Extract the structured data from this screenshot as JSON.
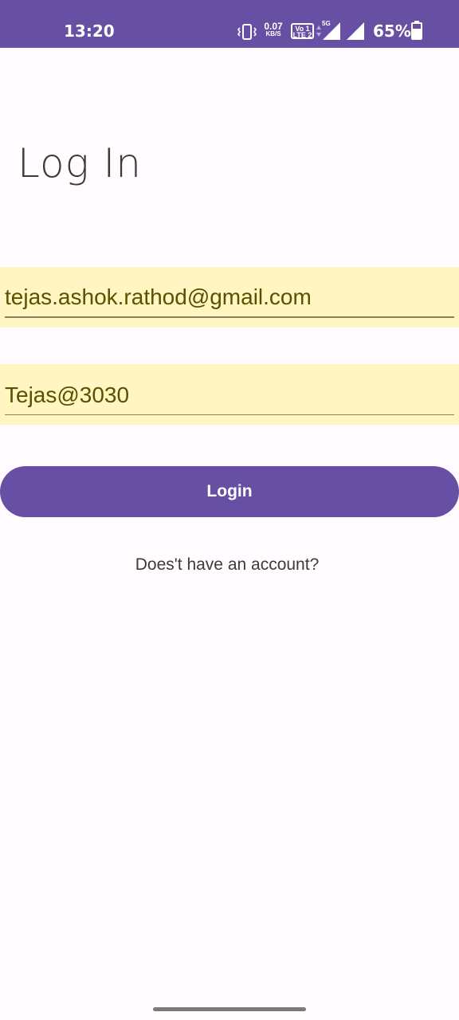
{
  "status_bar": {
    "time": "13:20",
    "net_speed_value": "0.07",
    "net_speed_unit": "KB/S",
    "volte_top": "Vo 1",
    "volte_bottom": "LTE 2",
    "network_type": "5G",
    "battery_percent": "65%",
    "icons": [
      "vibrate-icon",
      "volte-icon",
      "signal-5g-icon",
      "signal-icon",
      "battery-icon"
    ],
    "color": "#6750a4"
  },
  "login": {
    "title": "Log In",
    "email_value": "tejas.ashok.rathod@gmail.com",
    "password_value": "Tejas@3030",
    "button_label": "Login",
    "signup_prompt": "Does't have an account?"
  },
  "colors": {
    "accent": "#6750a4",
    "field_background": "#fff6c2",
    "background": "#fffbfe"
  }
}
